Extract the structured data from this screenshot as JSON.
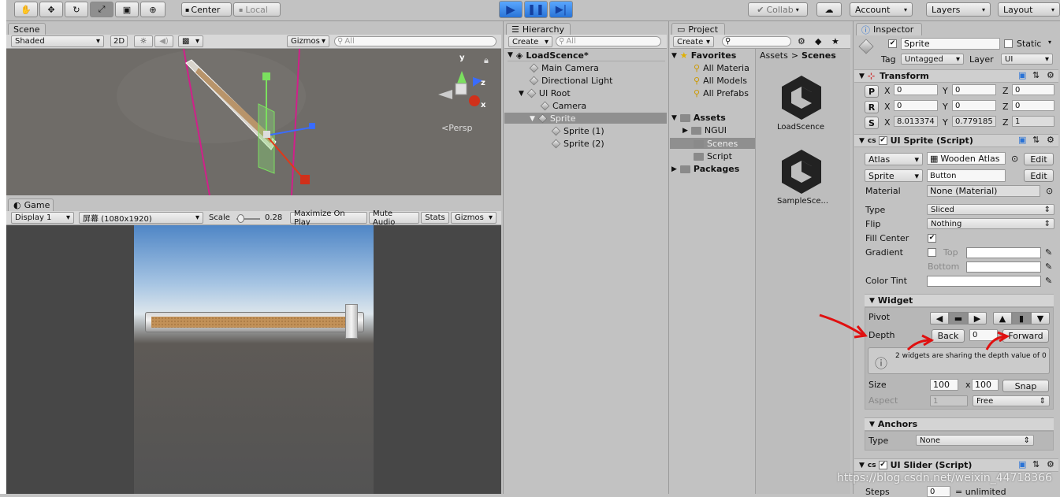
{
  "toolbar": {
    "pivot_center": "Center",
    "pivot_local": "Local",
    "collab": "Collab",
    "account": "Account",
    "layers": "Layers",
    "layout": "Layout"
  },
  "scene": {
    "tab": "Scene",
    "shading": "Shaded",
    "mode_2d": "2D",
    "gizmos": "Gizmos",
    "search_placeholder": "All",
    "persp": "Persp",
    "axis_y": "y",
    "axis_z": "z",
    "axis_x": "x"
  },
  "game": {
    "tab": "Game",
    "display": "Display 1",
    "resolution": "屏幕 (1080x1920)",
    "scale_label": "Scale",
    "scale_value": "0.28",
    "maximize": "Maximize On Play",
    "mute": "Mute Audio",
    "stats": "Stats",
    "gizmos": "Gizmos"
  },
  "hierarchy": {
    "tab": "Hierarchy",
    "create": "Create",
    "search_placeholder": "All",
    "scene_name": "LoadScence*",
    "items": [
      "Main Camera",
      "Directional Light",
      "UI Root",
      "Camera",
      "Sprite",
      "Sprite (1)",
      "Sprite (2)"
    ]
  },
  "project": {
    "tab": "Project",
    "create": "Create",
    "favorites": "Favorites",
    "fav_items": [
      "All Materia",
      "All Models",
      "All Prefabs"
    ],
    "assets": "Assets",
    "asset_items": [
      "NGUI",
      "Scenes",
      "Script"
    ],
    "packages": "Packages",
    "breadcrumb_root": "Assets",
    "breadcrumb_current": "Scenes",
    "files": [
      "LoadScence",
      "SampleSce..."
    ]
  },
  "inspector": {
    "tab": "Inspector",
    "name": "Sprite",
    "static": "Static",
    "tag_label": "Tag",
    "tag_value": "Untagged",
    "layer_label": "Layer",
    "layer_value": "UI",
    "transform": {
      "title": "Transform",
      "p": "P",
      "r": "R",
      "s": "S",
      "x": "X",
      "y": "Y",
      "z": "Z",
      "pos": [
        "0",
        "0",
        "0"
      ],
      "rot": [
        "0",
        "0",
        "0"
      ],
      "scale": [
        "8.013374",
        "0.779185",
        "1"
      ]
    },
    "ui_sprite": {
      "title": "UI Sprite (Script)",
      "atlas_label": "Atlas",
      "atlas_value": "Wooden Atlas",
      "sprite_label": "Sprite",
      "sprite_value": "Button",
      "edit": "Edit",
      "material_label": "Material",
      "material_value": "None (Material)",
      "type_label": "Type",
      "type_value": "Sliced",
      "flip_label": "Flip",
      "flip_value": "Nothing",
      "fill_center": "Fill Center",
      "gradient": "Gradient",
      "top": "Top",
      "bottom": "Bottom",
      "color_tint": "Color Tint"
    },
    "widget": {
      "title": "Widget",
      "pivot": "Pivot",
      "depth": "Depth",
      "back": "Back",
      "depth_value": "0",
      "forward": "Forward",
      "warning": "2 widgets are sharing the depth value of 0",
      "size": "Size",
      "width": "100",
      "height": "100",
      "by": "x",
      "snap": "Snap",
      "aspect": "Aspect",
      "aspect_value": "1",
      "aspect_mode": "Free"
    },
    "anchors": {
      "title": "Anchors",
      "type_label": "Type",
      "type_value": "None"
    },
    "ui_slider": {
      "title": "UI Slider (Script)",
      "steps_label": "Steps",
      "steps_value": "0",
      "steps_note": "= unlimited"
    }
  },
  "watermark": "https://blog.csdn.net/weixin_44718366"
}
